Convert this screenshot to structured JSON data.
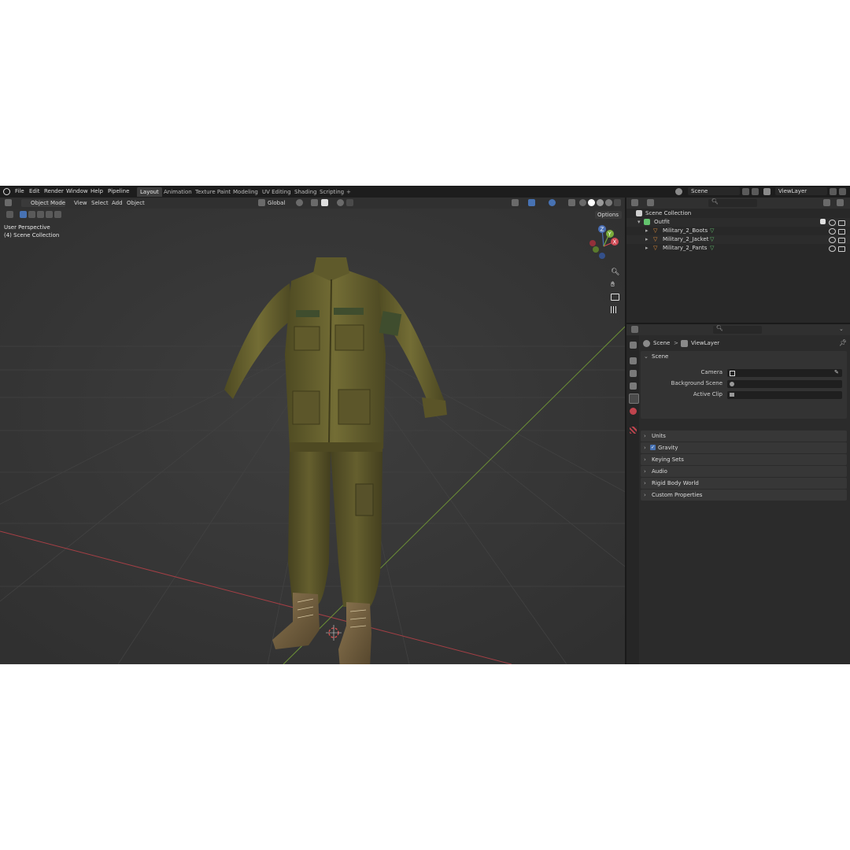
{
  "topbar": {
    "menu": [
      "File",
      "Edit",
      "Render",
      "Window",
      "Help",
      "Pipeline"
    ],
    "workspaces": [
      "Layout",
      "Animation",
      "Texture Paint",
      "Modeling",
      "UV Editing",
      "Shading",
      "Scripting"
    ],
    "add_tab": "+",
    "scene_name": "Scene",
    "view_layer_name": "ViewLayer"
  },
  "viewport": {
    "mode": "Object Mode",
    "menus": [
      "View",
      "Select",
      "Add",
      "Object"
    ],
    "orientation": "Global",
    "options_label": "Options",
    "overlay_line1": "User Perspective",
    "overlay_line2": "(4) Scene Collection",
    "gizmo_z": "Z",
    "gizmo_y": "Y",
    "gizmo_x": "X"
  },
  "outliner": {
    "root": "Scene Collection",
    "collection": "Outfit",
    "items": [
      "Military_2_Boots",
      "Military_2_Jacket",
      "Military_2_Pants"
    ]
  },
  "properties": {
    "breadcrumb_scene": "Scene",
    "breadcrumb_sep": ">",
    "breadcrumb_layer": "ViewLayer",
    "scene_panel": "Scene",
    "camera_label": "Camera",
    "background_scene_label": "Background Scene",
    "active_clip_label": "Active Clip",
    "panels": [
      "Units",
      "Gravity",
      "Keying Sets",
      "Audio",
      "Rigid Body World",
      "Custom Properties"
    ]
  },
  "colors": {
    "accent_blue": "#4772b3",
    "collection_green": "#63c46e",
    "object_orange": "#e8913a",
    "axis_red": "#c8484e",
    "axis_green": "#7bab3c"
  }
}
